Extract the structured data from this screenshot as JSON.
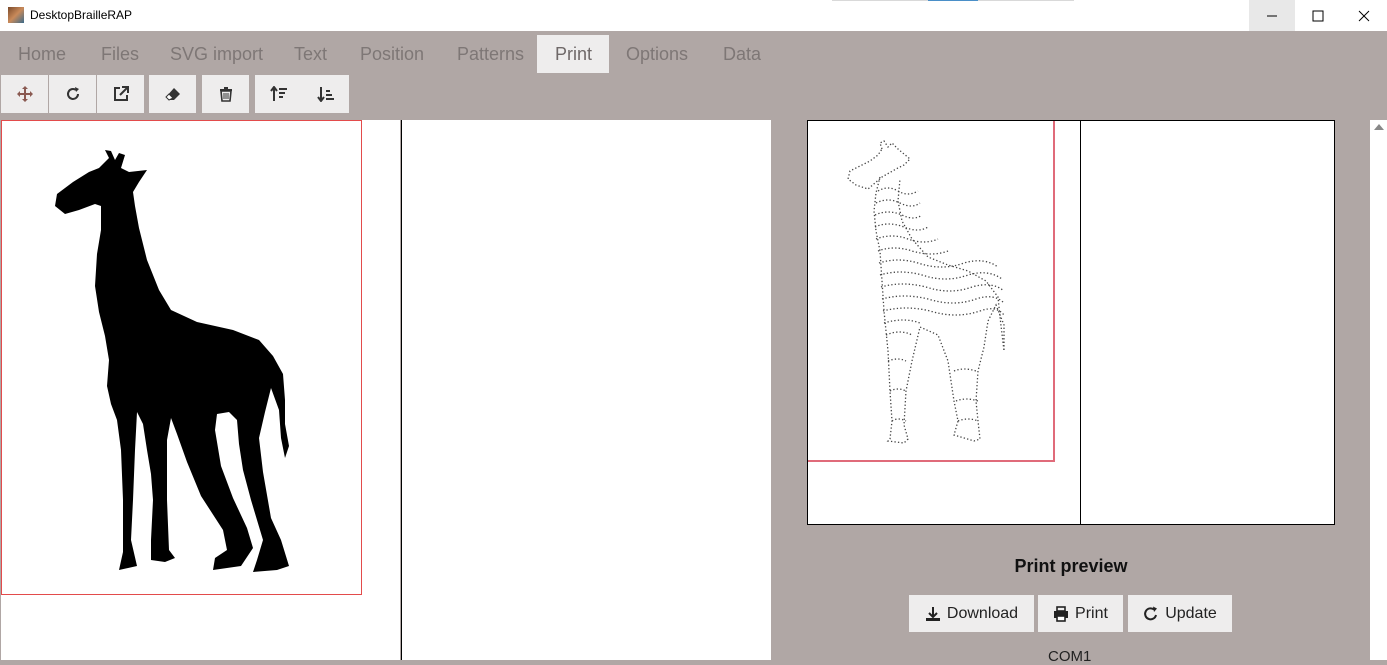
{
  "window": {
    "title": "DesktopBrailleRAP"
  },
  "tabs": [
    "Home",
    "Files",
    "SVG import",
    "Text",
    "Position",
    "Patterns",
    "Print",
    "Options",
    "Data"
  ],
  "active_tab": "Print",
  "toolbar": {
    "icons": [
      "move-icon",
      "refresh-icon",
      "external-link-icon",
      "eraser-icon",
      "trash-icon",
      "sort-ascending-icon",
      "sort-descending-icon"
    ]
  },
  "preview": {
    "title": "Print preview",
    "buttons": {
      "download": "Download",
      "print": "Print",
      "update": "Update"
    },
    "port": "COM1"
  },
  "colors": {
    "background": "#b0a7a5",
    "frame": "#e34b4b",
    "button": "#eeeded"
  }
}
